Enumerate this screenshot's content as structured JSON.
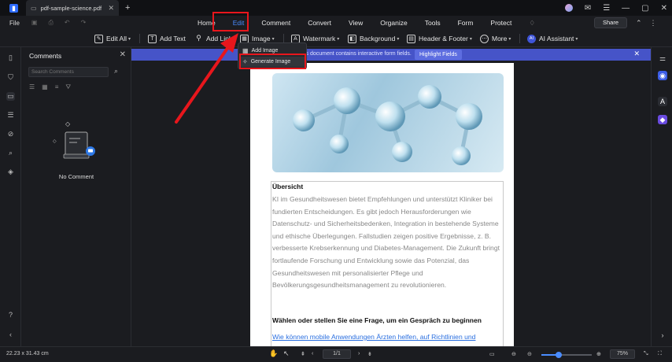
{
  "titlebar": {
    "tab_title": "pdf-sample-science.pdf",
    "tab_close": "✕",
    "new_tab": "+",
    "controls": [
      "✉",
      "☰",
      "—",
      "▢",
      "✕"
    ]
  },
  "menubar": {
    "file": "File",
    "items": [
      "Home",
      "Edit",
      "Comment",
      "Convert",
      "View",
      "Organize",
      "Tools",
      "Form",
      "Protect"
    ],
    "active": "Edit",
    "share": "Share"
  },
  "toolbar": {
    "edit_all": "Edit All",
    "add_text": "Add Text",
    "add_link": "Add Link",
    "image": "Image",
    "watermark": "Watermark",
    "background": "Background",
    "header_footer": "Header & Footer",
    "more": "More",
    "ai_assistant": "AI Assistant",
    "ai_badge": "AI"
  },
  "image_menu": {
    "items": [
      "Add Image",
      "Generate Image"
    ]
  },
  "comments": {
    "title": "Comments",
    "search_placeholder": "Search Comments",
    "empty": "No Comment"
  },
  "banner": {
    "text": "is document contains interactive form fields.",
    "button": "Highlight Fields"
  },
  "document": {
    "section_title": "Übersicht",
    "body": "KI im Gesundheitswesen bietet Empfehlungen und unterstützt Kliniker bei fundierten Entscheidungen.  Es gibt jedoch Herausforderungen wie Datenschutz- und Sicherheitsbedenken, Integration in bestehende Systeme und ethische Überlegungen. Fallstudien zeigen positive Ergebnisse, z. B.  verbesserte Krebserkennung und Diabetes-Management. Die Zukunft bringt fortlaufende Forschung  und Entwicklung sowie das Potenzial, das Gesundheitswesen mit personalisierter Pflege und Bevölkerungsgesundheitsmanagement zu revolutionieren.",
    "question": "Wählen oder stellen Sie eine Frage, um ein Gespräch zu beginnen",
    "link": "Wie können mobile Anwendungen Ärzten helfen, auf Richtlinien und"
  },
  "statusbar": {
    "dimensions": "22.23 x 31.43 cm",
    "page": "1/1",
    "zoom": "75%",
    "zoom_level": 0.35
  },
  "colors": {
    "accent": "#4a8cff",
    "highlight_red": "#e8161c",
    "banner": "#4654c8"
  }
}
